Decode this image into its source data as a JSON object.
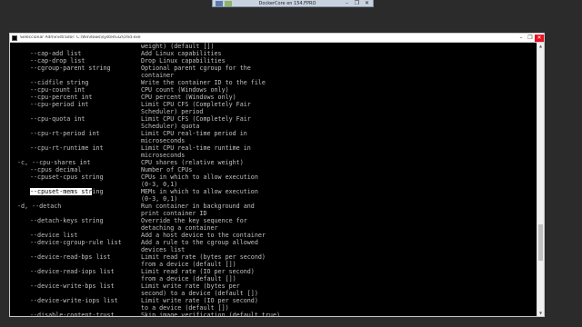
{
  "rdp": {
    "title": "DockerCore en 154.FPRO",
    "controls": [
      "–",
      "❐",
      "✕"
    ]
  },
  "window": {
    "title": "Seleccionar Administrador: C:\\Windows\\system32\\cmd.exe",
    "controls": [
      "–",
      "❐",
      "✕"
    ]
  },
  "console_lines": [
    {
      "opt": "",
      "desc": "weight) (default [])"
    },
    {
      "opt": "--cap-add list",
      "desc": "Add Linux capabilities"
    },
    {
      "opt": "--cap-drop list",
      "desc": "Drop Linux capabilities"
    },
    {
      "opt": "--cgroup-parent string",
      "desc": "Optional parent cgroup for the"
    },
    {
      "opt": "",
      "desc": "container"
    },
    {
      "opt": "--cidfile string",
      "desc": "Write the container ID to the file"
    },
    {
      "opt": "--cpu-count int",
      "desc": "CPU count (Windows only)"
    },
    {
      "opt": "--cpu-percent int",
      "desc": "CPU percent (Windows only)"
    },
    {
      "opt": "--cpu-period int",
      "desc": "Limit CPU CFS (Completely Fair"
    },
    {
      "opt": "",
      "desc": "Scheduler) period"
    },
    {
      "opt": "--cpu-quota int",
      "desc": "Limit CPU CFS (Completely Fair"
    },
    {
      "opt": "",
      "desc": "Scheduler) quota"
    },
    {
      "opt": "--cpu-rt-period int",
      "desc": "Limit CPU real-time period in"
    },
    {
      "opt": "",
      "desc": "microseconds"
    },
    {
      "opt": "--cpu-rt-runtime int",
      "desc": "Limit CPU real-time runtime in"
    },
    {
      "opt": "",
      "desc": "microseconds"
    },
    {
      "opt": "-c, --cpu-shares int",
      "desc": "CPU shares (relative weight)"
    },
    {
      "opt": "--cpus decimal",
      "desc": "Number of CPUs"
    },
    {
      "opt": "--cpuset-cpus string",
      "desc": "CPUs in which to allow execution"
    },
    {
      "opt": "",
      "desc": "(0-3, 0,1)"
    },
    {
      "opt": "--cpuset-mems string",
      "desc": "MEMs in which to allow execution",
      "highlight": "--cpuset-mems str"
    },
    {
      "opt": "",
      "desc": "(0-3, 0,1)"
    },
    {
      "opt": "-d, --detach",
      "desc": "Run container in background and"
    },
    {
      "opt": "",
      "desc": "print container ID"
    },
    {
      "opt": "--detach-keys string",
      "desc": "Override the key sequence for"
    },
    {
      "opt": "",
      "desc": "detaching a container"
    },
    {
      "opt": "--device list",
      "desc": "Add a host device to the container"
    },
    {
      "opt": "--device-cgroup-rule list",
      "desc": "Add a rule to the cgroup allowed"
    },
    {
      "opt": "",
      "desc": "devices list"
    },
    {
      "opt": "--device-read-bps list",
      "desc": "Limit read rate (bytes per second)"
    },
    {
      "opt": "",
      "desc": "from a device (default [])"
    },
    {
      "opt": "--device-read-iops list",
      "desc": "Limit read rate (IO per second)"
    },
    {
      "opt": "",
      "desc": "from a device (default [])"
    },
    {
      "opt": "--device-write-bps list",
      "desc": "Limit write rate (bytes per"
    },
    {
      "opt": "",
      "desc": "second) to a device (default [])"
    },
    {
      "opt": "--device-write-iops list",
      "desc": "Limit write rate (IO per second)"
    },
    {
      "opt": "",
      "desc": "to a device (default [])"
    },
    {
      "opt": "--disable-content-trust",
      "desc": "Skip image verification (default true)"
    }
  ]
}
